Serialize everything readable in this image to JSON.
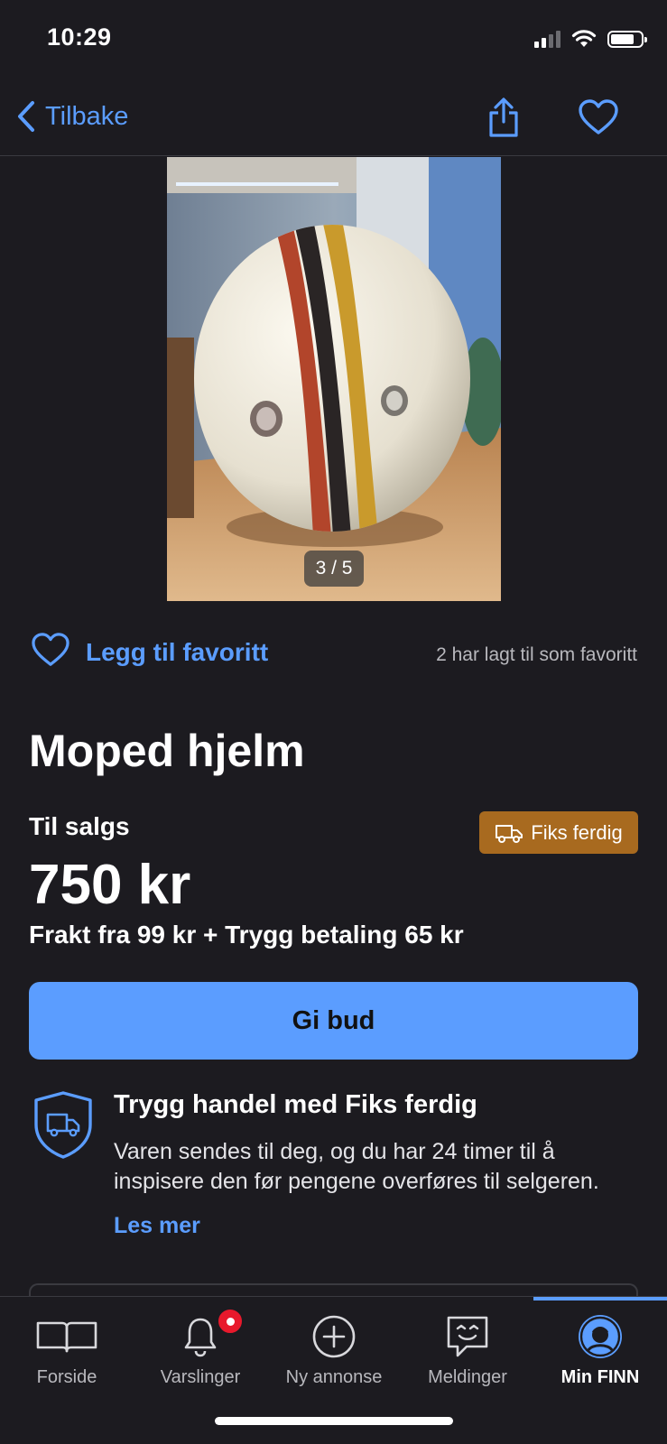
{
  "status_bar": {
    "time": "10:29"
  },
  "nav": {
    "back_label": "Tilbake"
  },
  "gallery": {
    "counter": "3 / 5"
  },
  "favorite": {
    "label": "Legg til favoritt",
    "count_text": "2 har lagt til som favoritt"
  },
  "listing": {
    "title": "Moped hjelm",
    "sale_type": "Til salgs",
    "badge_label": "Fiks ferdig",
    "price": "750 kr",
    "shipping": "Frakt fra 99 kr + Trygg betaling 65 kr",
    "bid_button": "Gi bud"
  },
  "safe_trade": {
    "title": "Trygg handel med Fiks ferdig",
    "text": "Varen sendes til deg, og du har 24 timer til å inspisere den før pengene overføres til selgeren.",
    "link": "Les mer"
  },
  "tabs": [
    {
      "label": "Forside",
      "icon": "book-icon"
    },
    {
      "label": "Varslinger",
      "icon": "bell-icon"
    },
    {
      "label": "Ny annonse",
      "icon": "plus-circle-icon"
    },
    {
      "label": "Meldinger",
      "icon": "chat-icon"
    },
    {
      "label": "Min FINN",
      "icon": "profile-icon"
    }
  ],
  "colors": {
    "accent": "#5b9dff",
    "badge": "#a86a1f",
    "background": "#1c1b20",
    "notification": "#e8192c"
  }
}
